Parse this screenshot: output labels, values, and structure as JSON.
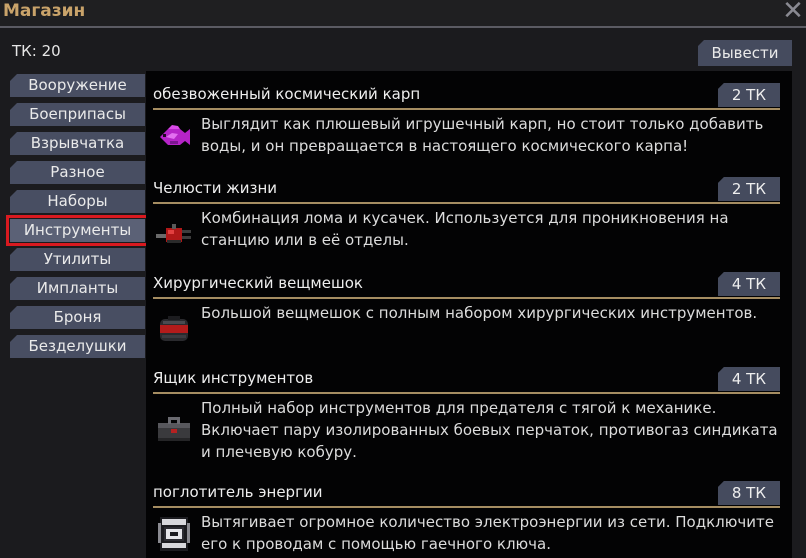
{
  "window": {
    "title": "Магазин"
  },
  "balance": {
    "text": "ТК: 20"
  },
  "toolbar": {
    "withdraw_label": "Вывести"
  },
  "categories": [
    {
      "label": "Вооружение",
      "active": false
    },
    {
      "label": "Боеприпасы",
      "active": false
    },
    {
      "label": "Взрывчатка",
      "active": false
    },
    {
      "label": "Разное",
      "active": false
    },
    {
      "label": "Наборы",
      "active": false
    },
    {
      "label": "Инструменты",
      "active": true
    },
    {
      "label": "Утилиты",
      "active": false
    },
    {
      "label": "Импланты",
      "active": false
    },
    {
      "label": "Броня",
      "active": false
    },
    {
      "label": "Безделушки",
      "active": false
    }
  ],
  "listings": [
    {
      "name": "обезвоженный космический карп",
      "price": "2 ТК",
      "icon": "space-carp-icon",
      "description": "Выглядит как плюшевый игрушечный карп, но стоит только добавить воды, и он превращается в настоящего космического карпа!"
    },
    {
      "name": "Челюсти жизни",
      "price": "2 ТК",
      "icon": "jaws-of-life-icon",
      "description": "Комбинация лома и кусачек. Используется для проникновения на станцию или в её отделы."
    },
    {
      "name": "Хирургический вещмешок",
      "price": "4 ТК",
      "icon": "surgical-duffel-icon",
      "description": "Большой вещмешок с полным набором хирургических инструментов."
    },
    {
      "name": "Ящик инструментов",
      "price": "4 ТК",
      "icon": "toolbox-icon",
      "description": "Полный набор инструментов для предателя с тягой к механике. Включает пару изолированных боевых перчаток, противогаз синдиката и плечевую кобуру."
    },
    {
      "name": "поглотитель энергии",
      "price": "8 ТК",
      "icon": "power-sink-icon",
      "description": "Вытягивает огромное количество электроэнергии из сети. Подключите его к проводам с помощью гаечного ключа."
    }
  ],
  "colors": {
    "title": "#c9a36a",
    "button": "#454b5e",
    "rule": "#a58d62",
    "active_outline": "#d91a20"
  }
}
